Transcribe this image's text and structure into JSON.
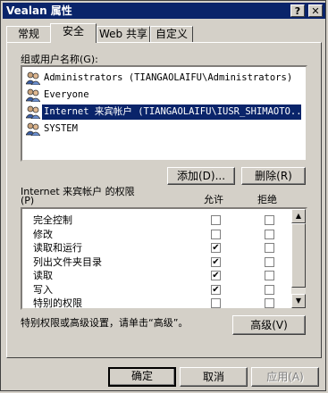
{
  "window": {
    "title": "Vealan 属性",
    "help_btn": "?",
    "close_btn": "✕"
  },
  "tabs": [
    {
      "label": "常规",
      "active": false
    },
    {
      "label": "安全",
      "active": true
    },
    {
      "label": "Web 共享",
      "active": false
    },
    {
      "label": "自定义",
      "active": false
    }
  ],
  "groups_label": "组或用户名称(G):",
  "users": [
    {
      "name": "Administrators (TIANGAOLAIFU\\Administrators)",
      "selected": false
    },
    {
      "name": "Everyone",
      "selected": false
    },
    {
      "name": "Internet 来宾帐户 (TIANGAOLAIFU\\IUSR_SHIMAOTO...",
      "selected": true
    },
    {
      "name": "SYSTEM",
      "selected": false
    }
  ],
  "add_button": "添加(D)...",
  "remove_button": "删除(R)",
  "perm_label_line1": "Internet 来宾帐户 的权限",
  "perm_label_line2": "(P)",
  "allow_header": "允许",
  "deny_header": "拒绝",
  "permissions": [
    {
      "name": "完全控制",
      "allow": false,
      "deny": false
    },
    {
      "name": "修改",
      "allow": false,
      "deny": false
    },
    {
      "name": "读取和运行",
      "allow": true,
      "deny": false
    },
    {
      "name": "列出文件夹目录",
      "allow": true,
      "deny": false
    },
    {
      "name": "读取",
      "allow": true,
      "deny": false
    },
    {
      "name": "写入",
      "allow": true,
      "deny": false
    },
    {
      "name": "特别的权限",
      "allow": false,
      "deny": false
    }
  ],
  "advanced_text": "特别权限或高级设置，请单击“高级”。",
  "advanced_button": "高级(V)",
  "ok_button": "确定",
  "cancel_button": "取消",
  "apply_button": "应用(A)",
  "colors": {
    "titlebar": "#0a246a",
    "face": "#d4d0c8",
    "selection": "#0a246a"
  }
}
